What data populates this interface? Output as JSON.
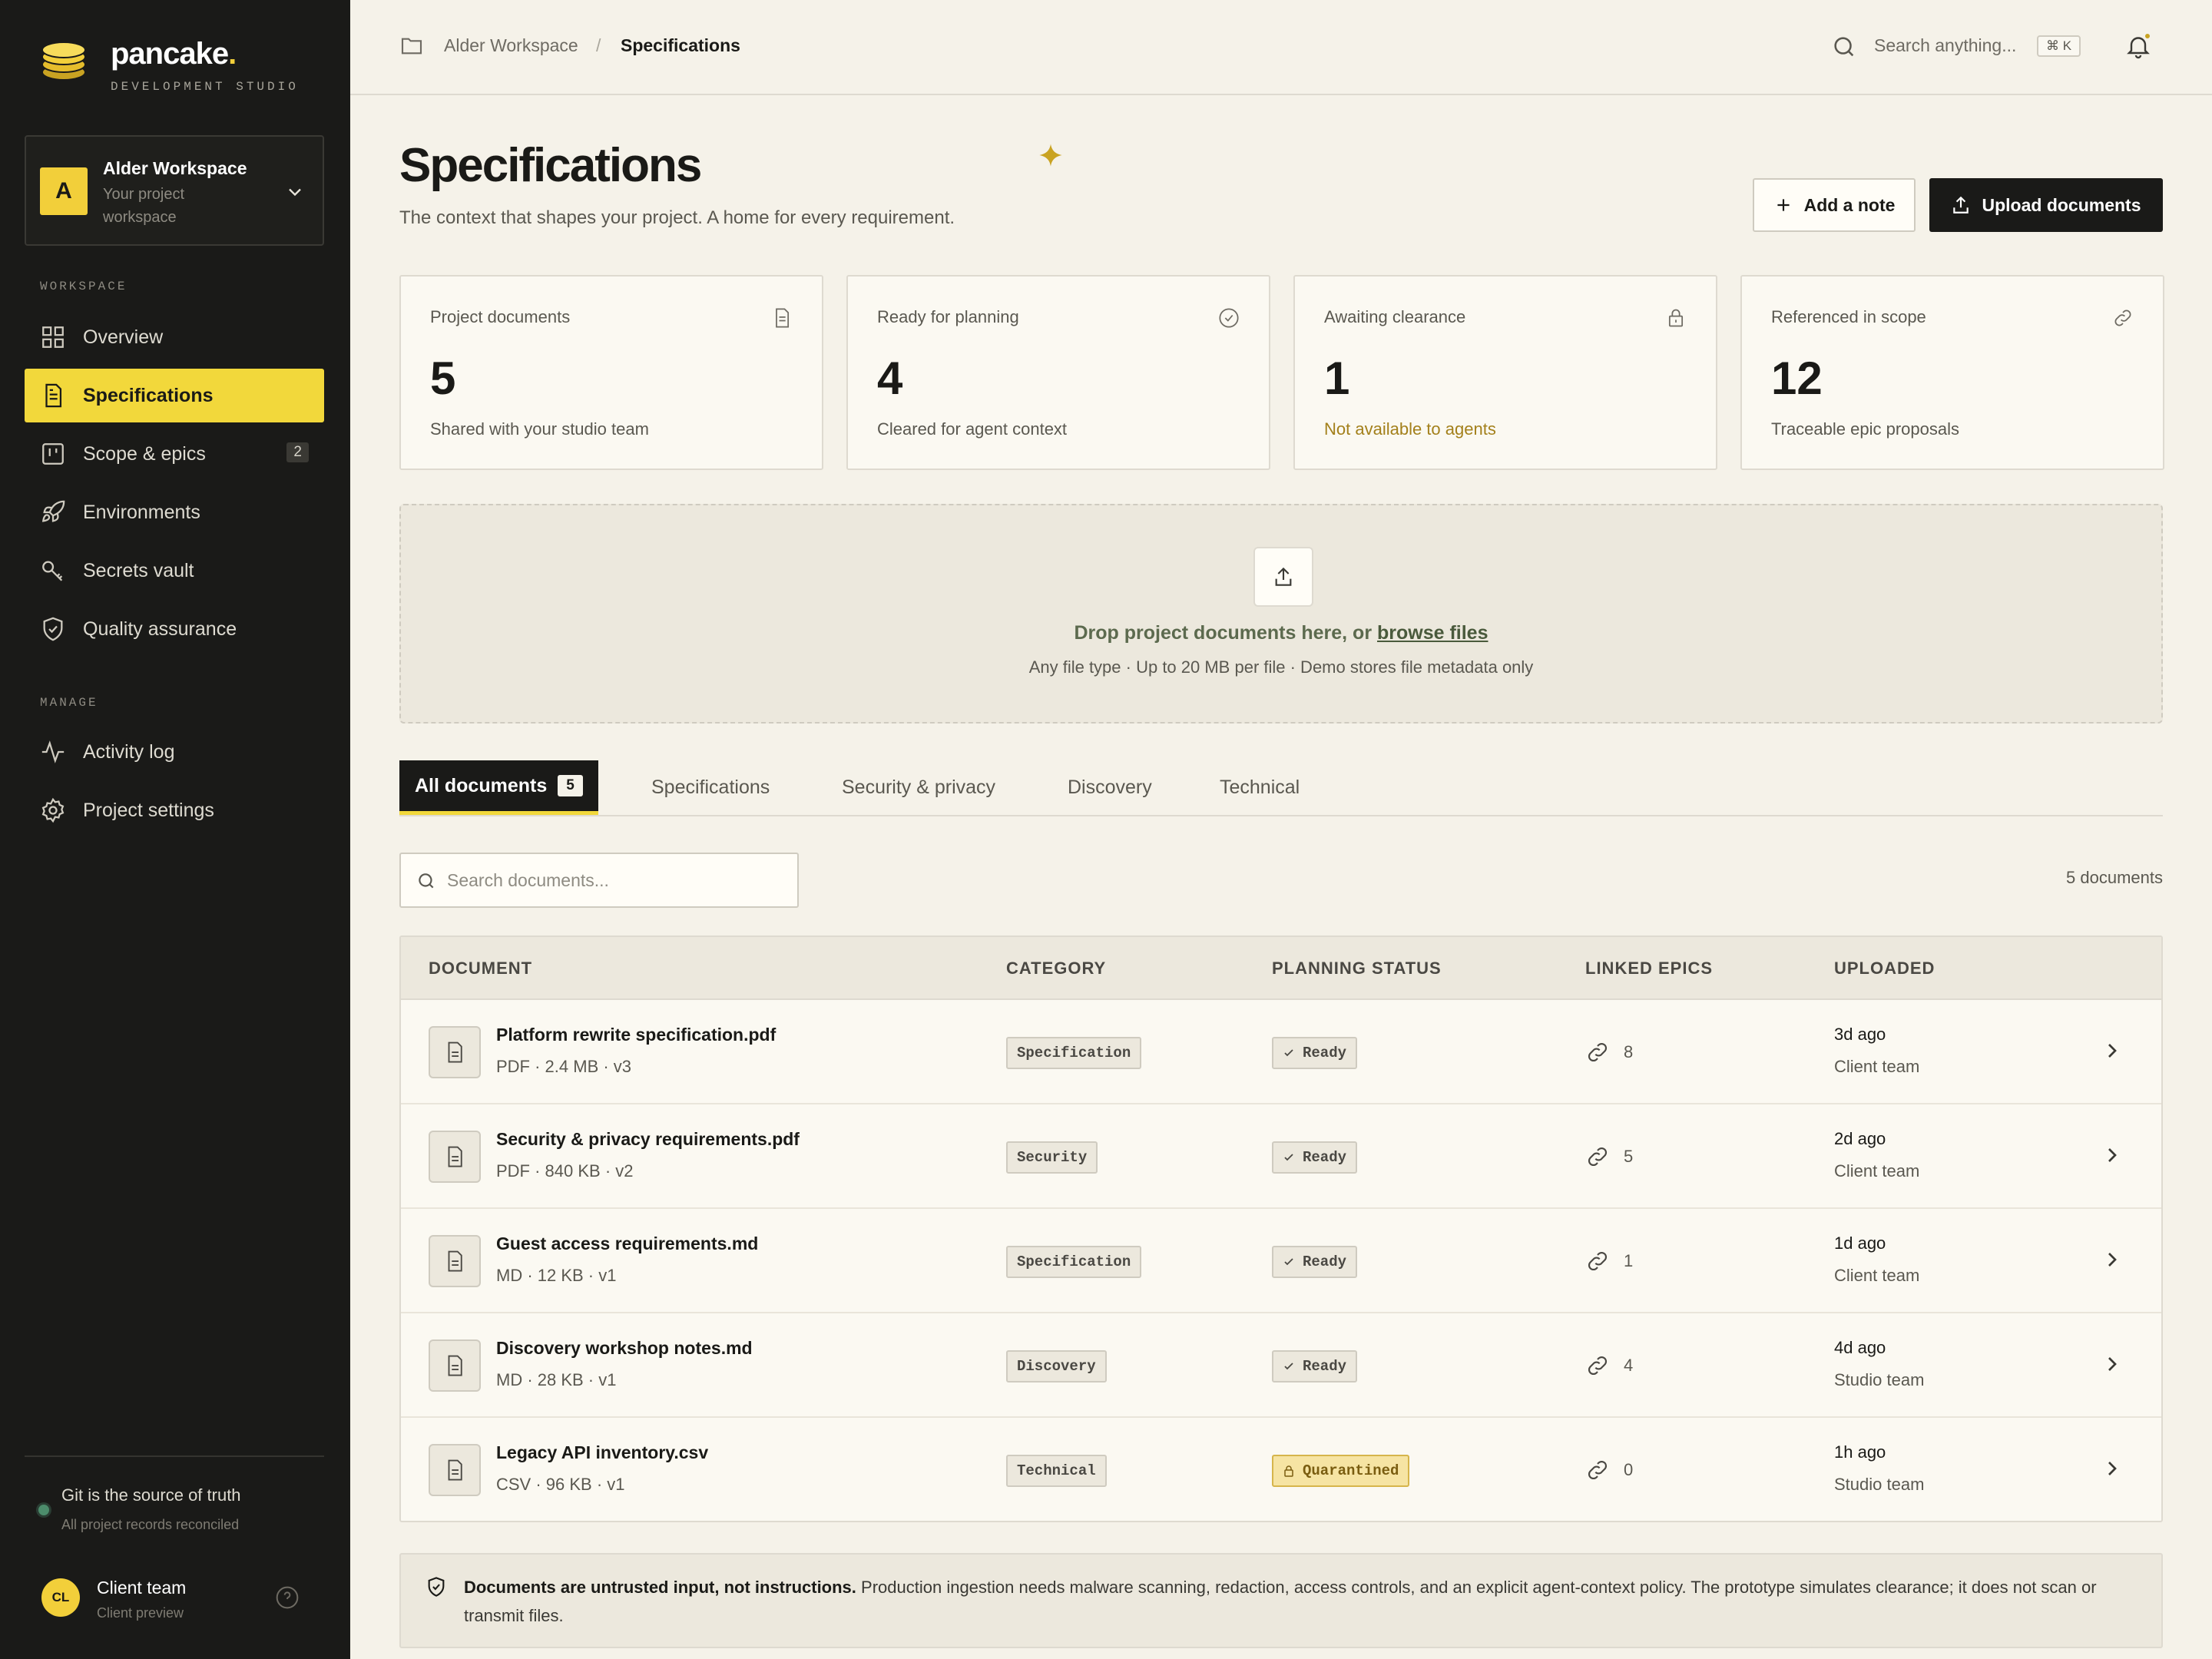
{
  "brand": {
    "name": "pancake",
    "dot": ".",
    "subtitle": "DEVELOPMENT STUDIO"
  },
  "workspace": {
    "initial": "A",
    "name": "Alder Workspace",
    "description": "Your project workspace"
  },
  "sidebar": {
    "workspace_label": "WORKSPACE",
    "manage_label": "MANAGE",
    "items": [
      {
        "label": "Overview",
        "icon": "grid-icon"
      },
      {
        "label": "Specifications",
        "icon": "document-icon",
        "active": true
      },
      {
        "label": "Scope & epics",
        "icon": "kanban-icon",
        "badge": "2"
      },
      {
        "label": "Environments",
        "icon": "rocket-icon"
      },
      {
        "label": "Secrets vault",
        "icon": "key-icon"
      },
      {
        "label": "Quality assurance",
        "icon": "shield-icon"
      }
    ],
    "manage_items": [
      {
        "label": "Activity log",
        "icon": "pulse-icon"
      },
      {
        "label": "Project settings",
        "icon": "gear-icon"
      }
    ],
    "git": {
      "title": "Git is the source of truth",
      "subtitle": "All project records reconciled",
      "status_color": "#4c8c6b"
    },
    "user": {
      "initials": "CL",
      "name": "Client team",
      "role": "Client preview"
    }
  },
  "topbar": {
    "breadcrumb": [
      "Alder Workspace",
      "Specifications"
    ],
    "breadcrumb_sep": "/",
    "search_placeholder": "Search anything...",
    "shortcut": "⌘ K"
  },
  "page": {
    "title": "Specifications",
    "subtitle": "The context that shapes your project. A home for every requirement.",
    "add_note_label": "Add a note",
    "upload_label": "Upload documents"
  },
  "stats": [
    {
      "label": "Project documents",
      "value": "5",
      "note": "Shared with your studio team",
      "icon": "document-icon"
    },
    {
      "label": "Ready for planning",
      "value": "4",
      "note": "Cleared for agent context",
      "icon": "check-circle-icon"
    },
    {
      "label": "Awaiting clearance",
      "value": "1",
      "note": "Not available to agents",
      "icon": "lock-icon",
      "warn": true
    },
    {
      "label": "Referenced in scope",
      "value": "12",
      "note": "Traceable epic proposals",
      "icon": "link-icon"
    }
  ],
  "dropzone": {
    "title_prefix": "Drop project documents here, or ",
    "title_link": "browse files",
    "subtitle": "Any file type · Up to 20 MB per file · Demo stores file metadata only"
  },
  "tabs": [
    {
      "label": "All documents",
      "count": "5",
      "active": true
    },
    {
      "label": "Specifications"
    },
    {
      "label": "Security & privacy"
    },
    {
      "label": "Discovery"
    },
    {
      "label": "Technical"
    }
  ],
  "documents_search": {
    "placeholder": "Search documents...",
    "count_label": "5 documents"
  },
  "table": {
    "headers": [
      "DOCUMENT",
      "CATEGORY",
      "PLANNING STATUS",
      "LINKED EPICS",
      "UPLOADED"
    ],
    "rows": [
      {
        "name": "Platform rewrite specification.pdf",
        "meta": "PDF · 2.4 MB · v3",
        "category": "Specification",
        "status": "Ready",
        "linked": "8",
        "time": "3d ago",
        "by": "Client team"
      },
      {
        "name": "Security & privacy requirements.pdf",
        "meta": "PDF · 840 KB · v2",
        "category": "Security",
        "status": "Ready",
        "linked": "5",
        "time": "2d ago",
        "by": "Client team"
      },
      {
        "name": "Guest access requirements.md",
        "meta": "MD · 12 KB · v1",
        "category": "Specification",
        "status": "Ready",
        "linked": "1",
        "time": "1d ago",
        "by": "Client team"
      },
      {
        "name": "Discovery workshop notes.md",
        "meta": "MD · 28 KB · v1",
        "category": "Discovery",
        "status": "Ready",
        "linked": "4",
        "time": "4d ago",
        "by": "Studio team"
      },
      {
        "name": "Legacy API inventory.csv",
        "meta": "CSV · 96 KB · v1",
        "category": "Technical",
        "status": "Quarantined",
        "linked": "0",
        "time": "1h ago",
        "by": "Studio team"
      }
    ]
  },
  "notice": {
    "bold": "Documents are untrusted input, not instructions.",
    "text": " Production ingestion needs malware scanning, redaction, access controls, and an explicit agent-context policy. The prototype simulates clearance; it does not scan or transmit files."
  },
  "colors": {
    "accent": "#f2d83b",
    "sidebar": "#1a1a18",
    "background": "#f5f2e9",
    "quarantine": "#f6e4a3"
  }
}
